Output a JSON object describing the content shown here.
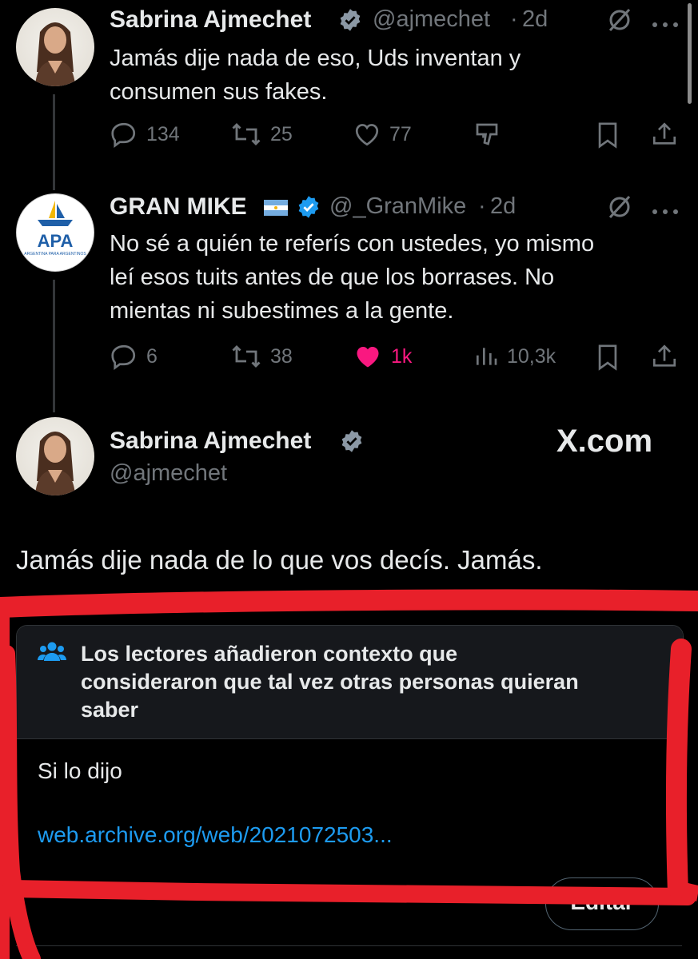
{
  "tweets": [
    {
      "name": "Sabrina Ajmechet",
      "handle": "@ajmechet",
      "time": "2d",
      "text_lines": [
        "Jamás dije nada de eso, Uds inventan y",
        "consumen sus fakes."
      ],
      "replies": "134",
      "retweets": "25",
      "likes": "77"
    },
    {
      "name": "GRAN MIKE",
      "handle": "@_GranMike",
      "time": "2d",
      "avatar_text": "APA",
      "avatar_subtext": "ARGENTINA PARA ARGENTINOS",
      "text_lines": [
        "No sé a quién te referís con ustedes, yo mismo",
        "leí esos tuits antes de que los borrases. No",
        "mientas ni subestimes a la gente."
      ],
      "replies": "6",
      "retweets": "38",
      "likes": "1k",
      "views": "10,3k"
    }
  ],
  "quoted": {
    "name": "Sabrina Ajmechet",
    "handle": "@ajmechet",
    "watermark": "X.com",
    "text": "Jamás dije nada de lo que vos decís. Jamás."
  },
  "note": {
    "header_lines": [
      "Los lectores añadieron contexto que",
      "consideraron que tal vez otras personas quieran",
      "saber"
    ],
    "text": "Si lo dijo",
    "link": "web.archive.org/web/2021072503..."
  },
  "edit_button": "Editar",
  "colors": {
    "background": "#000000",
    "text": "#e7e9ea",
    "muted": "#71767b",
    "link": "#1d9bf0",
    "like": "#f91880",
    "verified": "#1d9bf0",
    "annotation": "#e8202a"
  }
}
